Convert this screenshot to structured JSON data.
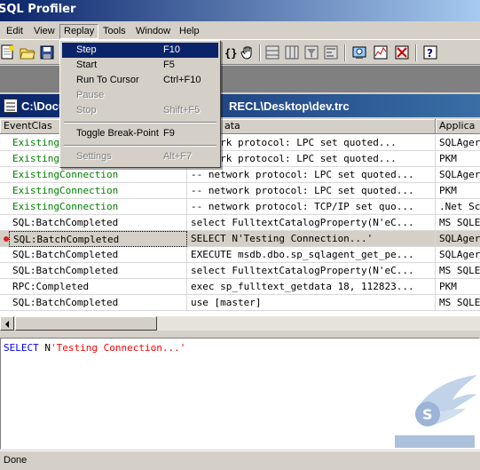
{
  "app": {
    "title": "SQL Profiler"
  },
  "menubar": {
    "items": [
      {
        "label": "Edit"
      },
      {
        "label": "View"
      },
      {
        "label": "Replay"
      },
      {
        "label": "Tools"
      },
      {
        "label": "Window"
      },
      {
        "label": "Help"
      }
    ]
  },
  "replay_menu": {
    "items": [
      {
        "label": "Step",
        "shortcut": "F10"
      },
      {
        "label": "Start",
        "shortcut": "F5"
      },
      {
        "label": "Run To Cursor",
        "shortcut": "Ctrl+F10"
      },
      {
        "label": "Pause",
        "shortcut": ""
      },
      {
        "label": "Stop",
        "shortcut": "Shift+F5"
      },
      {
        "label": "Toggle Break-Point",
        "shortcut": "F9"
      },
      {
        "label": "Settings",
        "shortcut": "Alt+F7"
      }
    ]
  },
  "child_window": {
    "title_left": "C:\\Docu",
    "title_right": "RECL\\Desktop\\dev.trc"
  },
  "grid": {
    "columns": [
      "EventClas",
      "ata",
      "Applica"
    ],
    "rows": [
      {
        "event": "Existing",
        "text": "network protocol: LPC set quoted...",
        "app": "SQLAger",
        "color": "#008000"
      },
      {
        "event": "Existing",
        "text": "network protocol: LPC set quoted...",
        "app": "PKM",
        "color": "#008000"
      },
      {
        "event": "ExistingConnection",
        "text": "-- network protocol: LPC set quoted...",
        "app": "SQLAger",
        "color": "#008000"
      },
      {
        "event": "ExistingConnection",
        "text": "-- network protocol: LPC set quoted...",
        "app": "PKM",
        "color": "#008000"
      },
      {
        "event": "ExistingConnection",
        "text": "-- network protocol: TCP/IP set quo...",
        "app": ".Net Sc",
        "color": "#008000"
      },
      {
        "event": "SQL:BatchCompleted",
        "text": "select FulltextCatalogProperty(N'eC...",
        "app": "MS SQLE",
        "color": "#000000"
      },
      {
        "event": "SQL:BatchCompleted",
        "text": "SELECT N'Testing Connection...'",
        "app": "SQLAger",
        "color": "#000000",
        "selected": true,
        "breakpoint": true
      },
      {
        "event": "SQL:BatchCompleted",
        "text": "EXECUTE msdb.dbo.sp_sqlagent_get_pe...",
        "app": "SQLAger",
        "color": "#000000"
      },
      {
        "event": "SQL:BatchCompleted",
        "text": "select FulltextCatalogProperty(N'eC...",
        "app": "MS SQLE",
        "color": "#000000"
      },
      {
        "event": "RPC:Completed",
        "text": "exec sp_fulltext_getdata 18, 112823...",
        "app": "PKM",
        "color": "#000000"
      },
      {
        "event": "SQL:BatchCompleted",
        "text": "use [master]",
        "app": "MS SQLE",
        "color": "#000000"
      }
    ]
  },
  "textpane": {
    "keyword": "SELECT",
    "prefix": " N",
    "string": "'Testing Connection...'"
  },
  "status": {
    "text": "Done"
  }
}
